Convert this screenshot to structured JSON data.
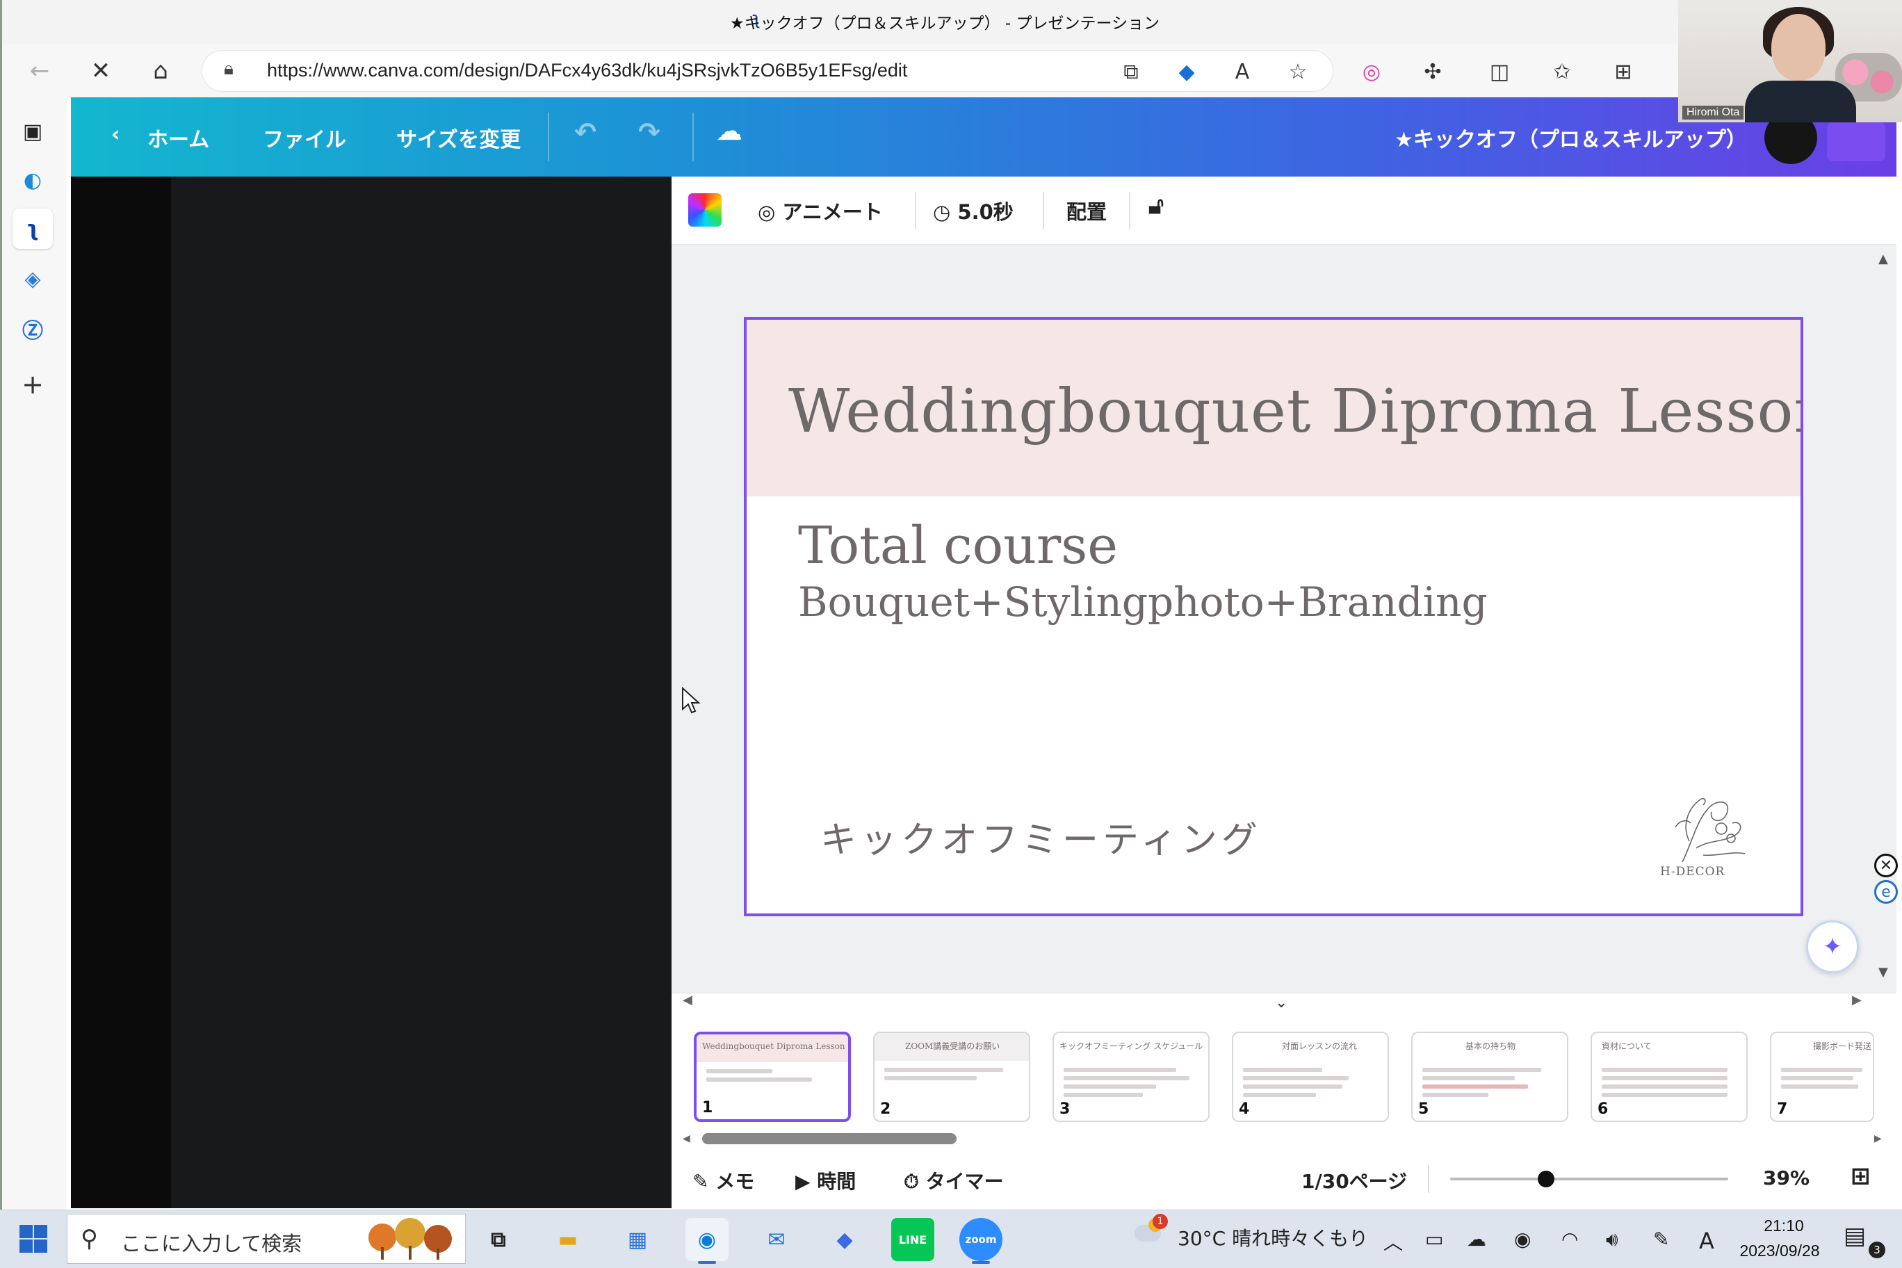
{
  "browser": {
    "window_title": "★キックオフ（プロ＆スキルアップ） - プレゼンテーション",
    "url": "https://www.canva.com/design/DAFcx4y63dk/ku4jSRsjvkTzO6B5y1EFsg/edit"
  },
  "canva_header": {
    "home": "ホーム",
    "file": "ファイル",
    "resize": "サイズを変更",
    "design_title": "★キックオフ（プロ＆スキルアップ）"
  },
  "editor_toolbar": {
    "animate": "アニメート",
    "duration": "5.0秒",
    "position": "配置"
  },
  "slide": {
    "title": "Weddingbouquet  Diproma Lesson",
    "subtitle1": "Total course",
    "subtitle2": "Bouquet+Stylingphoto+Branding",
    "japanese": "キックオフミーティング",
    "logo_text": "H-DECOR",
    "band_color": "#f6e7e7",
    "text_color": "#6e6868"
  },
  "thumbnails": [
    {
      "num": "1",
      "title": "Weddingbouquet  Diproma Lesson"
    },
    {
      "num": "2",
      "title": "ZOOM講義受講のお願い"
    },
    {
      "num": "3",
      "title": "キックオフミーティング スケジュール"
    },
    {
      "num": "4",
      "title": "対面レッスンの流れ"
    },
    {
      "num": "5",
      "title": "基本の持ち物"
    },
    {
      "num": "6",
      "title": "資材について"
    },
    {
      "num": "7",
      "title": "撮影ボード発送"
    }
  ],
  "footer": {
    "notes": "メモ",
    "timing": "時間",
    "timer": "タイマー",
    "page_indicator": "1/30ページ",
    "zoom": "39%",
    "zoom_fraction": 0.39
  },
  "video": {
    "participant_name": "Hiromi Ota"
  },
  "taskbar": {
    "search_placeholder": "ここに入力して検索",
    "weather": "30°C  晴れ時々くもり",
    "weather_badge": "1",
    "time": "21:10",
    "date": "2023/09/28",
    "notification_count": "3",
    "ime": "A"
  },
  "accent_color": "#7d4ef0"
}
